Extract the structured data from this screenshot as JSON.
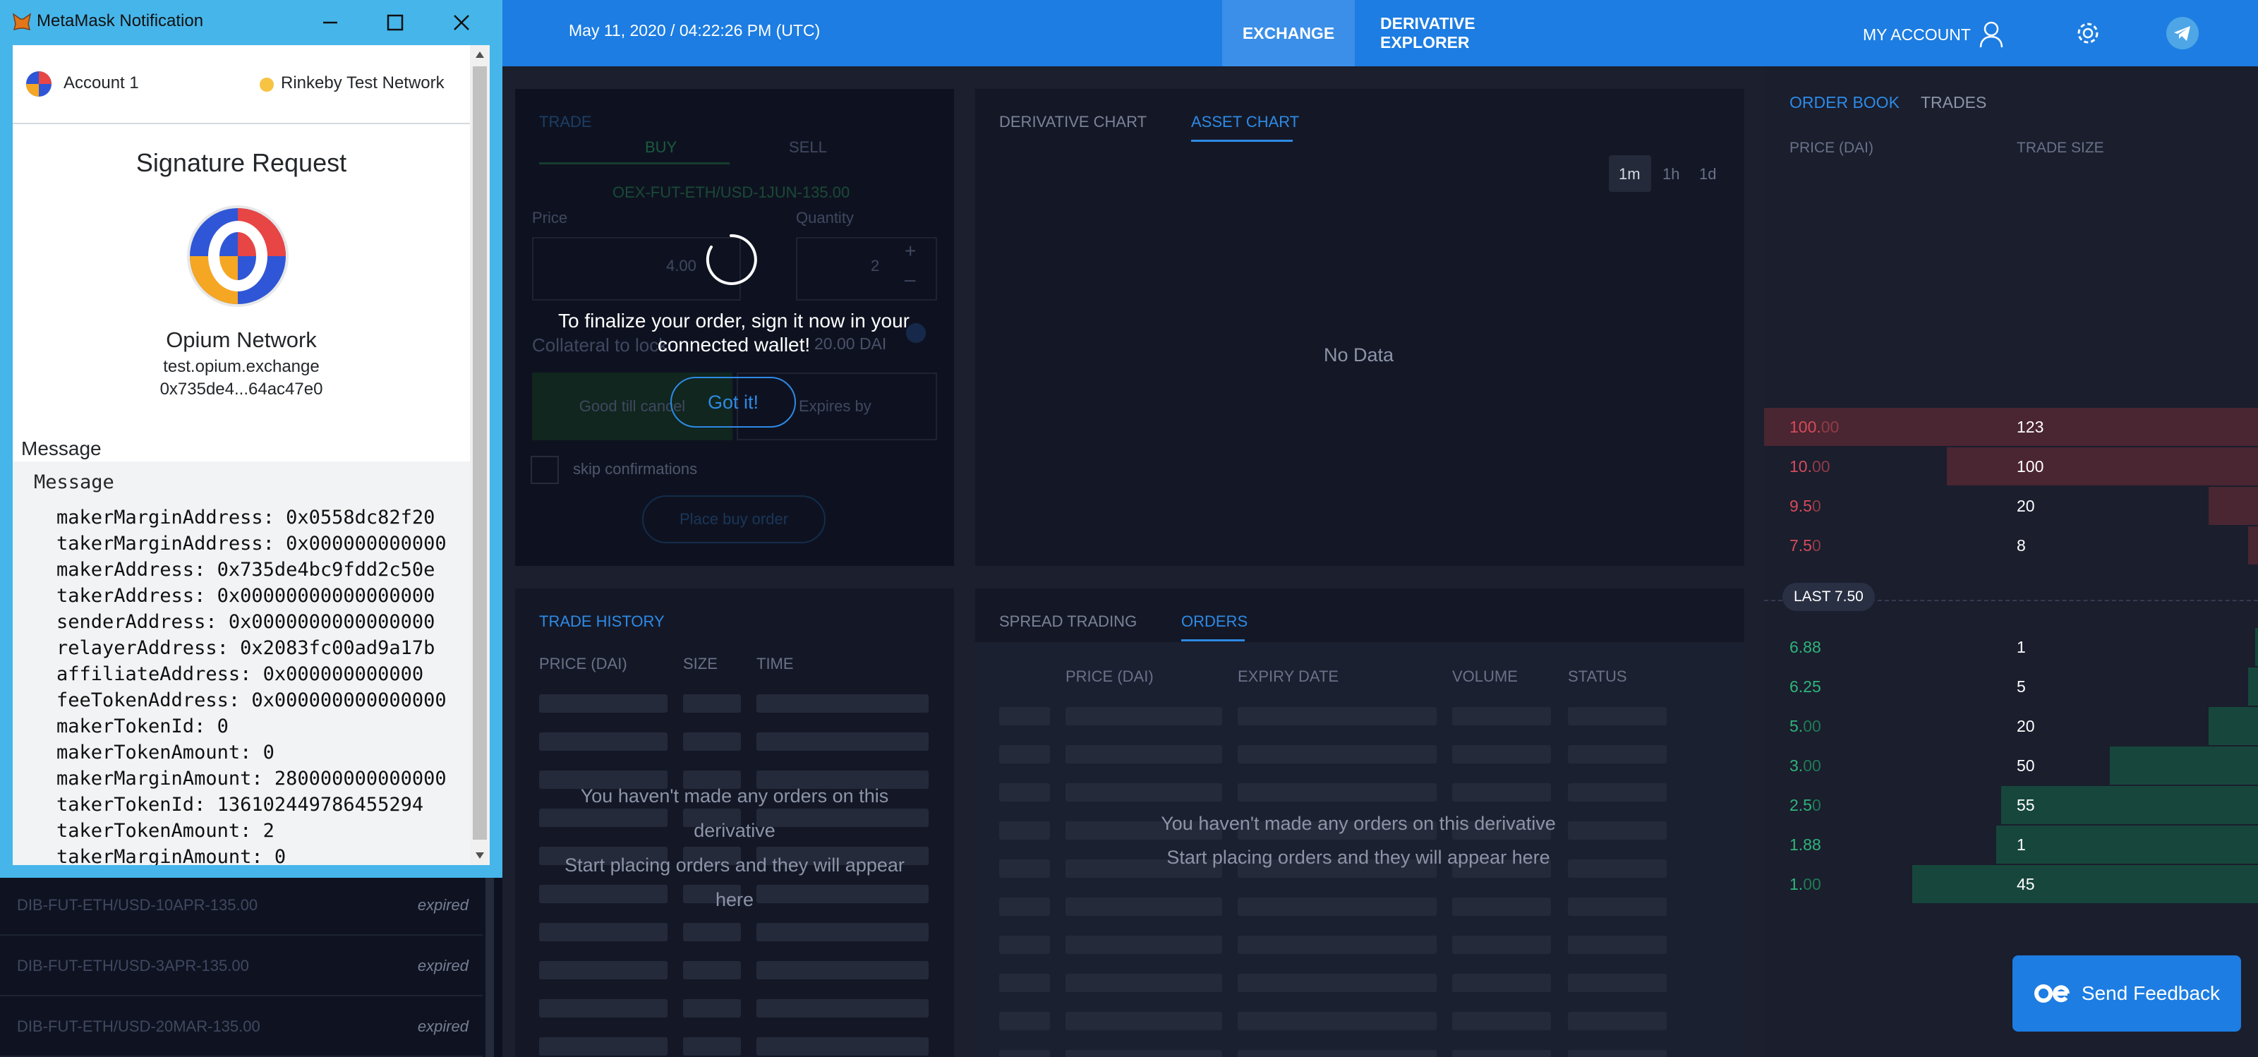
{
  "header": {
    "datetime": "May 11, 2020 / 04:22:26 PM (UTC)",
    "nav_exchange": "EXCHANGE",
    "nav_derivative_explorer": "DERIVATIVE EXPLORER",
    "my_account": "MY ACCOUNT"
  },
  "trade": {
    "title": "TRADE",
    "buy_tab": "BUY",
    "sell_tab": "SELL",
    "ticker": "OEX-FUT-ETH/USD-1JUN-135.00",
    "price_label": "Price",
    "price_value": "4.00",
    "quantity_label": "Quantity",
    "quantity_value": "2",
    "collateral_label": "Collateral to lock",
    "collateral_value": "20.00 DAI",
    "good_till_cancel": "Good till cancel",
    "expires_by": "Expires by",
    "skip_confirmations": "skip confirmations",
    "place_order": "Place buy order",
    "overlay_message": "To finalize your order, sign it now in your connected wallet!",
    "got_it": "Got it!"
  },
  "chart_panel": {
    "tab_derivative": "DERIVATIVE CHART",
    "tab_asset": "ASSET CHART",
    "range_1m": "1m",
    "range_1h": "1h",
    "range_1d": "1d",
    "empty": "No Data"
  },
  "trade_history": {
    "title": "TRADE HISTORY",
    "col_price": "PRICE (DAI)",
    "col_size": "SIZE",
    "col_time": "TIME",
    "empty_line1": "You haven't made any orders on this derivative",
    "empty_line2": "Start placing orders and they will appear here"
  },
  "orders_panel": {
    "tab_spread": "SPREAD TRADING",
    "tab_orders": "ORDERS",
    "col_price": "PRICE (DAI)",
    "col_expiry": "EXPIRY DATE",
    "col_volume": "VOLUME",
    "col_status": "STATUS",
    "empty_line1": "You haven't made any orders on this derivative",
    "empty_line2": "Start placing orders and they will appear here"
  },
  "orderbook": {
    "tab_orderbook": "ORDER BOOK",
    "tab_trades": "TRADES",
    "col_price": "PRICE (DAI)",
    "col_size": "TRADE SIZE",
    "last_label": "LAST 7.50",
    "asks": [
      {
        "price_main": "100.",
        "price_tail": "00",
        "size": "123",
        "fill": 1.0
      },
      {
        "price_main": "10.",
        "price_tail": "00",
        "size": "100",
        "fill": 0.63
      },
      {
        "price_main": "9.5",
        "price_tail": "0",
        "size": "20",
        "fill": 0.1
      },
      {
        "price_main": "7.5",
        "price_tail": "0",
        "size": "8",
        "fill": 0.02
      }
    ],
    "bids": [
      {
        "price_main": "6.88",
        "price_tail": "",
        "size": "1",
        "fill": 0.005
      },
      {
        "price_main": "6.25",
        "price_tail": "",
        "size": "5",
        "fill": 0.02
      },
      {
        "price_main": "5.",
        "price_tail": "00",
        "size": "20",
        "fill": 0.1
      },
      {
        "price_main": "3.",
        "price_tail": "00",
        "size": "50",
        "fill": 0.3
      },
      {
        "price_main": "2.5",
        "price_tail": "0",
        "size": "55",
        "fill": 0.52
      },
      {
        "price_main": "1.88",
        "price_tail": "",
        "size": "1",
        "fill": 0.53
      },
      {
        "price_main": "1.",
        "price_tail": "00",
        "size": "45",
        "fill": 0.7
      }
    ]
  },
  "feedback": {
    "label": "Send Feedback"
  },
  "left_list": [
    {
      "name": "DIB-FUT-ETH/USD-10APR-135.00",
      "status": "expired"
    },
    {
      "name": "DIB-FUT-ETH/USD-3APR-135.00",
      "status": "expired"
    },
    {
      "name": "DIB-FUT-ETH/USD-20MAR-135.00",
      "status": "expired"
    }
  ],
  "metamask": {
    "window_title": "MetaMask Notification",
    "account": "Account 1",
    "network": "Rinkeby Test Network",
    "heading": "Signature Request",
    "site_name": "Opium Network",
    "site_url": "test.opium.exchange",
    "site_address": "0x735de4...64ac47e0",
    "message_label": "Message",
    "message_sublabel": "Message",
    "lines": [
      "makerMarginAddress: 0x0558dc82f20",
      "takerMarginAddress: 0x000000000000",
      "makerAddress: 0x735de4bc9fdd2c50e",
      "takerAddress: 0x00000000000000000",
      "senderAddress: 0x0000000000000000",
      "relayerAddress: 0x2083fc00ad9a17b",
      "affiliateAddress: 0x000000000000",
      "feeTokenAddress: 0x000000000000000",
      "makerTokenId: 0",
      "makerTokenAmount: 0",
      "makerMarginAmount: 280000000000000",
      "takerTokenId: 136102449786455294",
      "takerTokenAmount: 2",
      "takerMarginAmount: 0"
    ]
  },
  "colors": {
    "accent": "#1d7de2",
    "ask": "#d64b5a",
    "bid": "#2fb47a"
  }
}
